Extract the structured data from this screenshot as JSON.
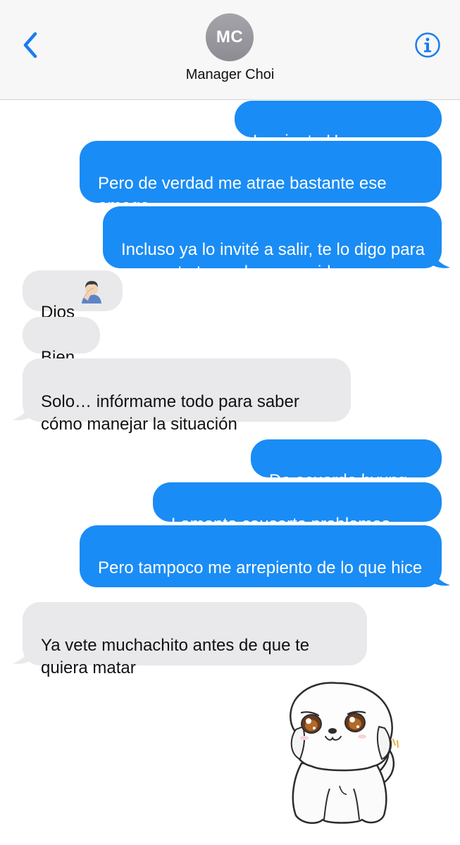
{
  "header": {
    "contact_initials": "MC",
    "contact_name": "Manager Choi",
    "back_icon": "chevron-left-icon",
    "info_icon": "info-circle-icon"
  },
  "messages": [
    {
      "direction": "outgoing",
      "text": "Lo siento Hyungggg"
    },
    {
      "direction": "outgoing",
      "text": "Pero de verdad me atrae bastante ese omega"
    },
    {
      "direction": "outgoing",
      "text": "Incluso ya lo invité a salir, te lo digo para que no te tome desprevenido"
    },
    {
      "direction": "incoming",
      "text": "Dios",
      "emoji": "face-palm-emoji"
    },
    {
      "direction": "incoming",
      "text": "Bien"
    },
    {
      "direction": "incoming",
      "text": "Solo… infórmame todo para saber cómo manejar la situación"
    },
    {
      "direction": "outgoing",
      "text": "De acuerdo hyung"
    },
    {
      "direction": "outgoing",
      "text": "Lamento causarte problemas"
    },
    {
      "direction": "outgoing",
      "text": "Pero tampoco me arrepiento de lo que hice"
    },
    {
      "direction": "incoming",
      "text": "Ya vete muchachito antes de que te quiera matar"
    }
  ],
  "sticker": {
    "name": "white-puppy-sticker"
  },
  "colors": {
    "outgoing_bubble": "#1a8cf5",
    "incoming_bubble": "#e9e9eb",
    "accent": "#1a7cf0",
    "header_bg": "#f7f7f7"
  }
}
